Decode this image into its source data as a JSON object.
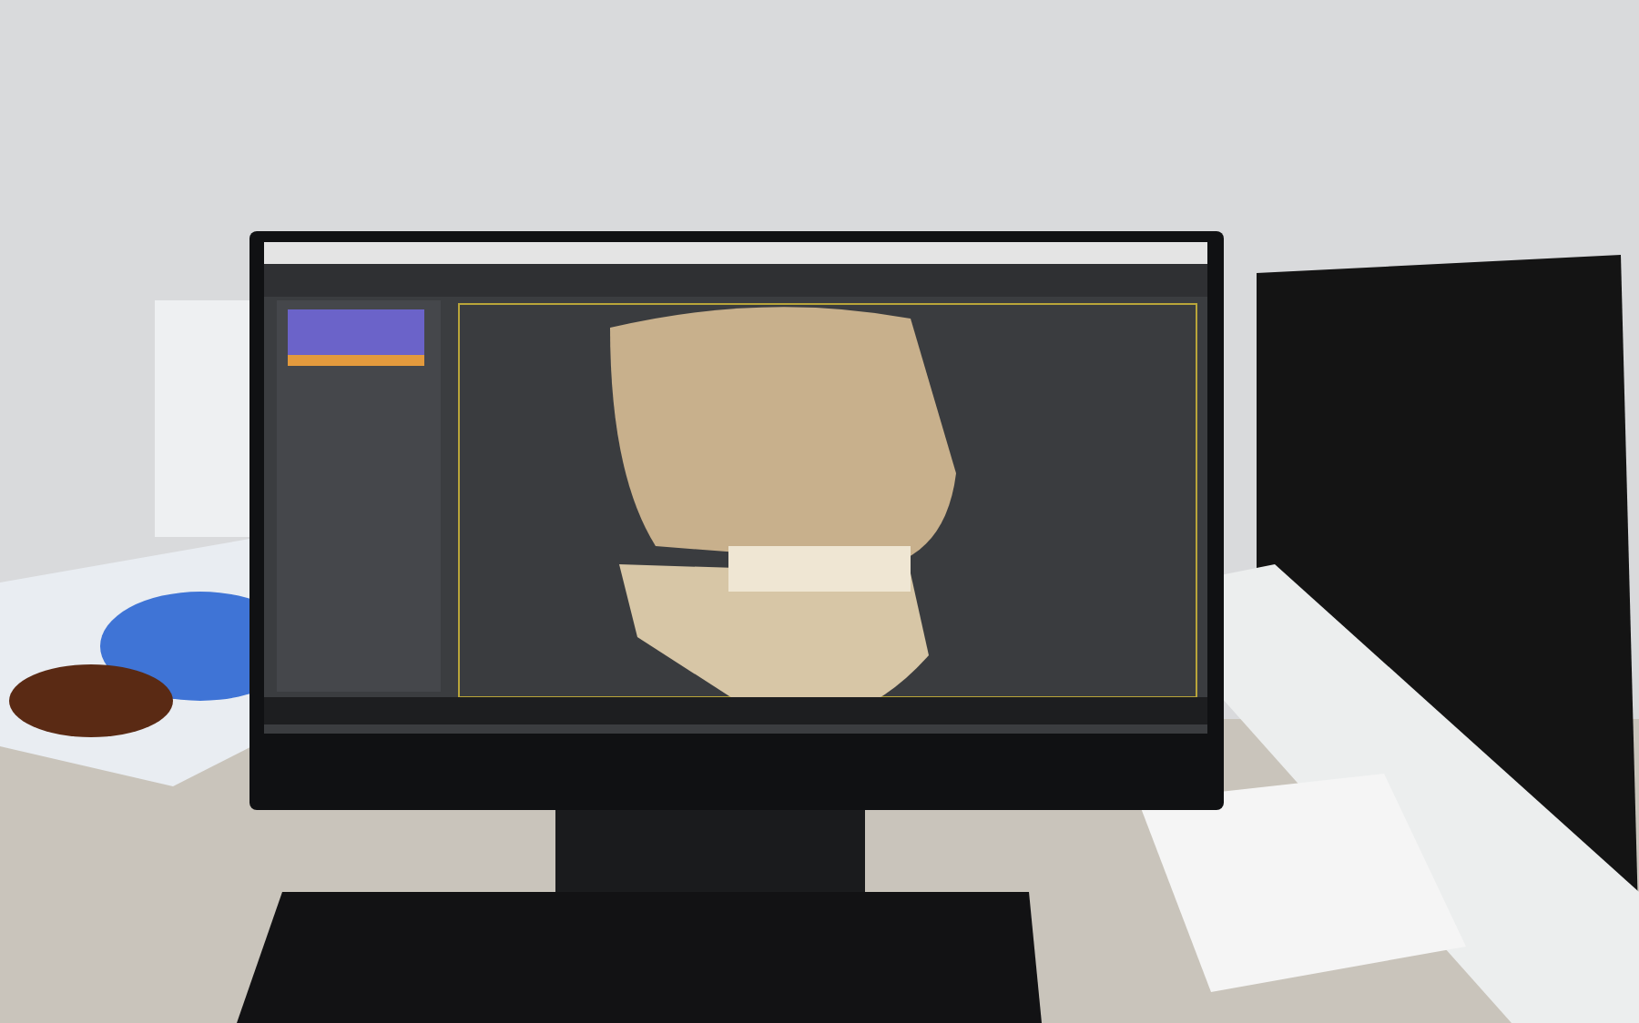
{
  "scene": {
    "kind": "photo"
  }
}
